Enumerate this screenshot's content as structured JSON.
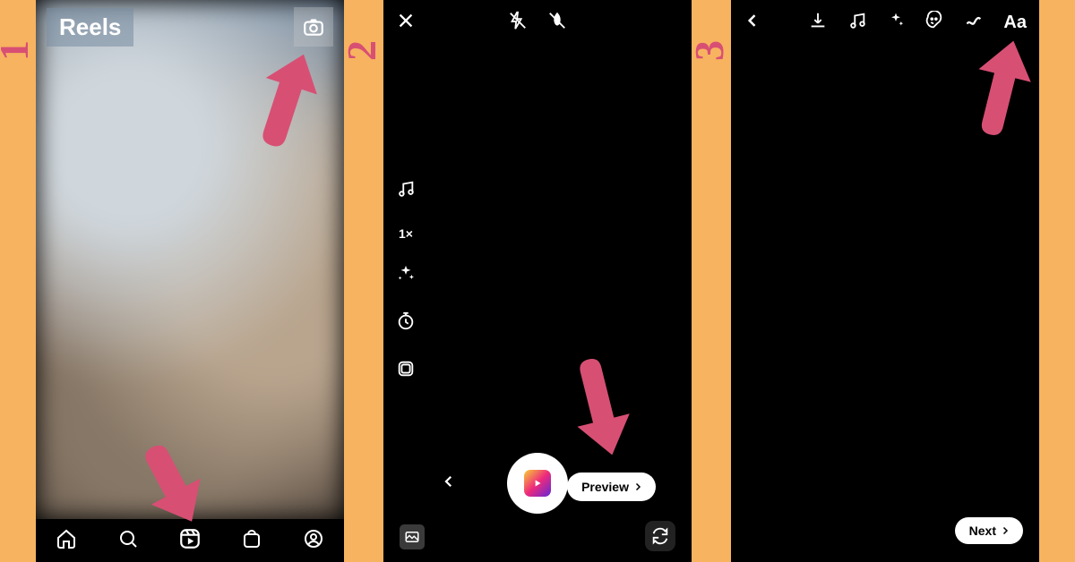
{
  "steps": {
    "one": "1",
    "two": "2",
    "three": "3"
  },
  "screen1": {
    "title": "Reels",
    "icons": {
      "camera": "camera-icon",
      "home": "home-icon",
      "search": "search-icon",
      "reels": "reels-icon",
      "shop": "shop-icon",
      "profile": "profile-icon"
    }
  },
  "screen2": {
    "icons": {
      "close": "close-icon",
      "flash_off": "flash-off-icon",
      "touchup": "touchup-icon",
      "music": "music-icon",
      "effects": "sparkle-icon",
      "timer": "timer-icon",
      "layout": "layout-icon",
      "gallery": "gallery-icon",
      "flip_camera": "flip-camera-icon",
      "back": "chevron-left-icon"
    },
    "speed_label": "1×",
    "preview_label": "Preview"
  },
  "screen3": {
    "icons": {
      "back": "chevron-left-icon",
      "download": "download-icon",
      "music": "music-icon",
      "effects": "sparkle-icon",
      "sticker": "sticker-icon",
      "draw": "draw-icon"
    },
    "text_tool_label": "Aa",
    "next_label": "Next"
  },
  "colors": {
    "accent": "#d84f74",
    "bg": "#f7b360"
  }
}
